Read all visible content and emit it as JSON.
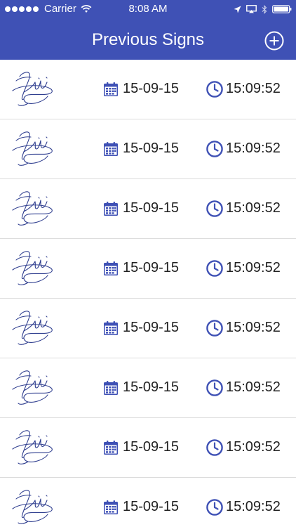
{
  "status_bar": {
    "carrier": "Carrier",
    "time": "8:08 AM",
    "icons": [
      "signal-dots",
      "wifi-icon",
      "location-arrow-icon",
      "airplay-icon",
      "bluetooth-icon",
      "battery-icon"
    ]
  },
  "header": {
    "title": "Previous Signs",
    "add_icon": "plus-circle-icon"
  },
  "colors": {
    "header_bg": "#3f51b5",
    "accent": "#3f51b5",
    "signature_ink": "#2f3e8f"
  },
  "signs": [
    {
      "date": "15-09-15",
      "time": "15:09:52"
    },
    {
      "date": "15-09-15",
      "time": "15:09:52"
    },
    {
      "date": "15-09-15",
      "time": "15:09:52"
    },
    {
      "date": "15-09-15",
      "time": "15:09:52"
    },
    {
      "date": "15-09-15",
      "time": "15:09:52"
    },
    {
      "date": "15-09-15",
      "time": "15:09:52"
    },
    {
      "date": "15-09-15",
      "time": "15:09:52"
    },
    {
      "date": "15-09-15",
      "time": "15:09:52"
    }
  ]
}
